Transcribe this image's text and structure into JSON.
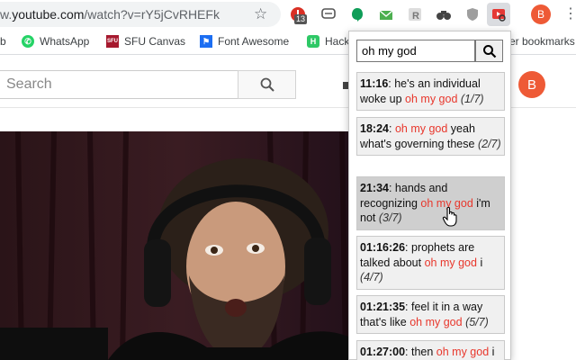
{
  "browser": {
    "url_dim": "w.",
    "url_main": "youtube.com",
    "url_path": "/watch?v=rY5jCvRHEFk",
    "badge_count": "13",
    "profile_initial": "B"
  },
  "bookmarks": [
    {
      "label": "b",
      "icon": "bookmark-icon"
    },
    {
      "label": "WhatsApp",
      "icon": "whatsapp-icon",
      "color": "#25d366"
    },
    {
      "label": "SFU Canvas",
      "icon": "sfu-icon",
      "color": "#a6192e"
    },
    {
      "label": "Font Awesome",
      "icon": "flag-icon",
      "color": "#1c6ef2"
    },
    {
      "label": "Hack",
      "icon": "hackerrank-icon",
      "color": "#2ec866"
    },
    {
      "label": "er bookmarks",
      "icon": "folder-icon"
    }
  ],
  "youtube": {
    "search_placeholder": "Search",
    "avatar_initial": "B"
  },
  "popup": {
    "query": "oh my god",
    "results": [
      {
        "time": "11:16",
        "before": ": he's an individual woke up ",
        "match": "oh my god",
        "after": " ",
        "index": "(1/7)"
      },
      {
        "time": "18:24",
        "before": ": ",
        "match": "oh my god",
        "after": " yeah what's governing these ",
        "index": "(2/7)"
      },
      {
        "time": "21:34",
        "before": ": hands and recognizing ",
        "match": "oh my god",
        "after": " i'm not ",
        "index": "(3/7)"
      },
      {
        "time": "01:16:26",
        "before": ": prophets are talked about ",
        "match": "oh my god",
        "after": " i ",
        "index": "(4/7)"
      },
      {
        "time": "01:21:35",
        "before": ": feel it in a way that's like ",
        "match": "oh my god",
        "after": " ",
        "index": "(5/7)"
      },
      {
        "time": "01:27:00",
        "before": ": then ",
        "match": "oh my god",
        "after": " i",
        "index": ""
      }
    ]
  },
  "colors": {
    "highlight": "#e8372c",
    "avatar": "#ee5a36"
  }
}
